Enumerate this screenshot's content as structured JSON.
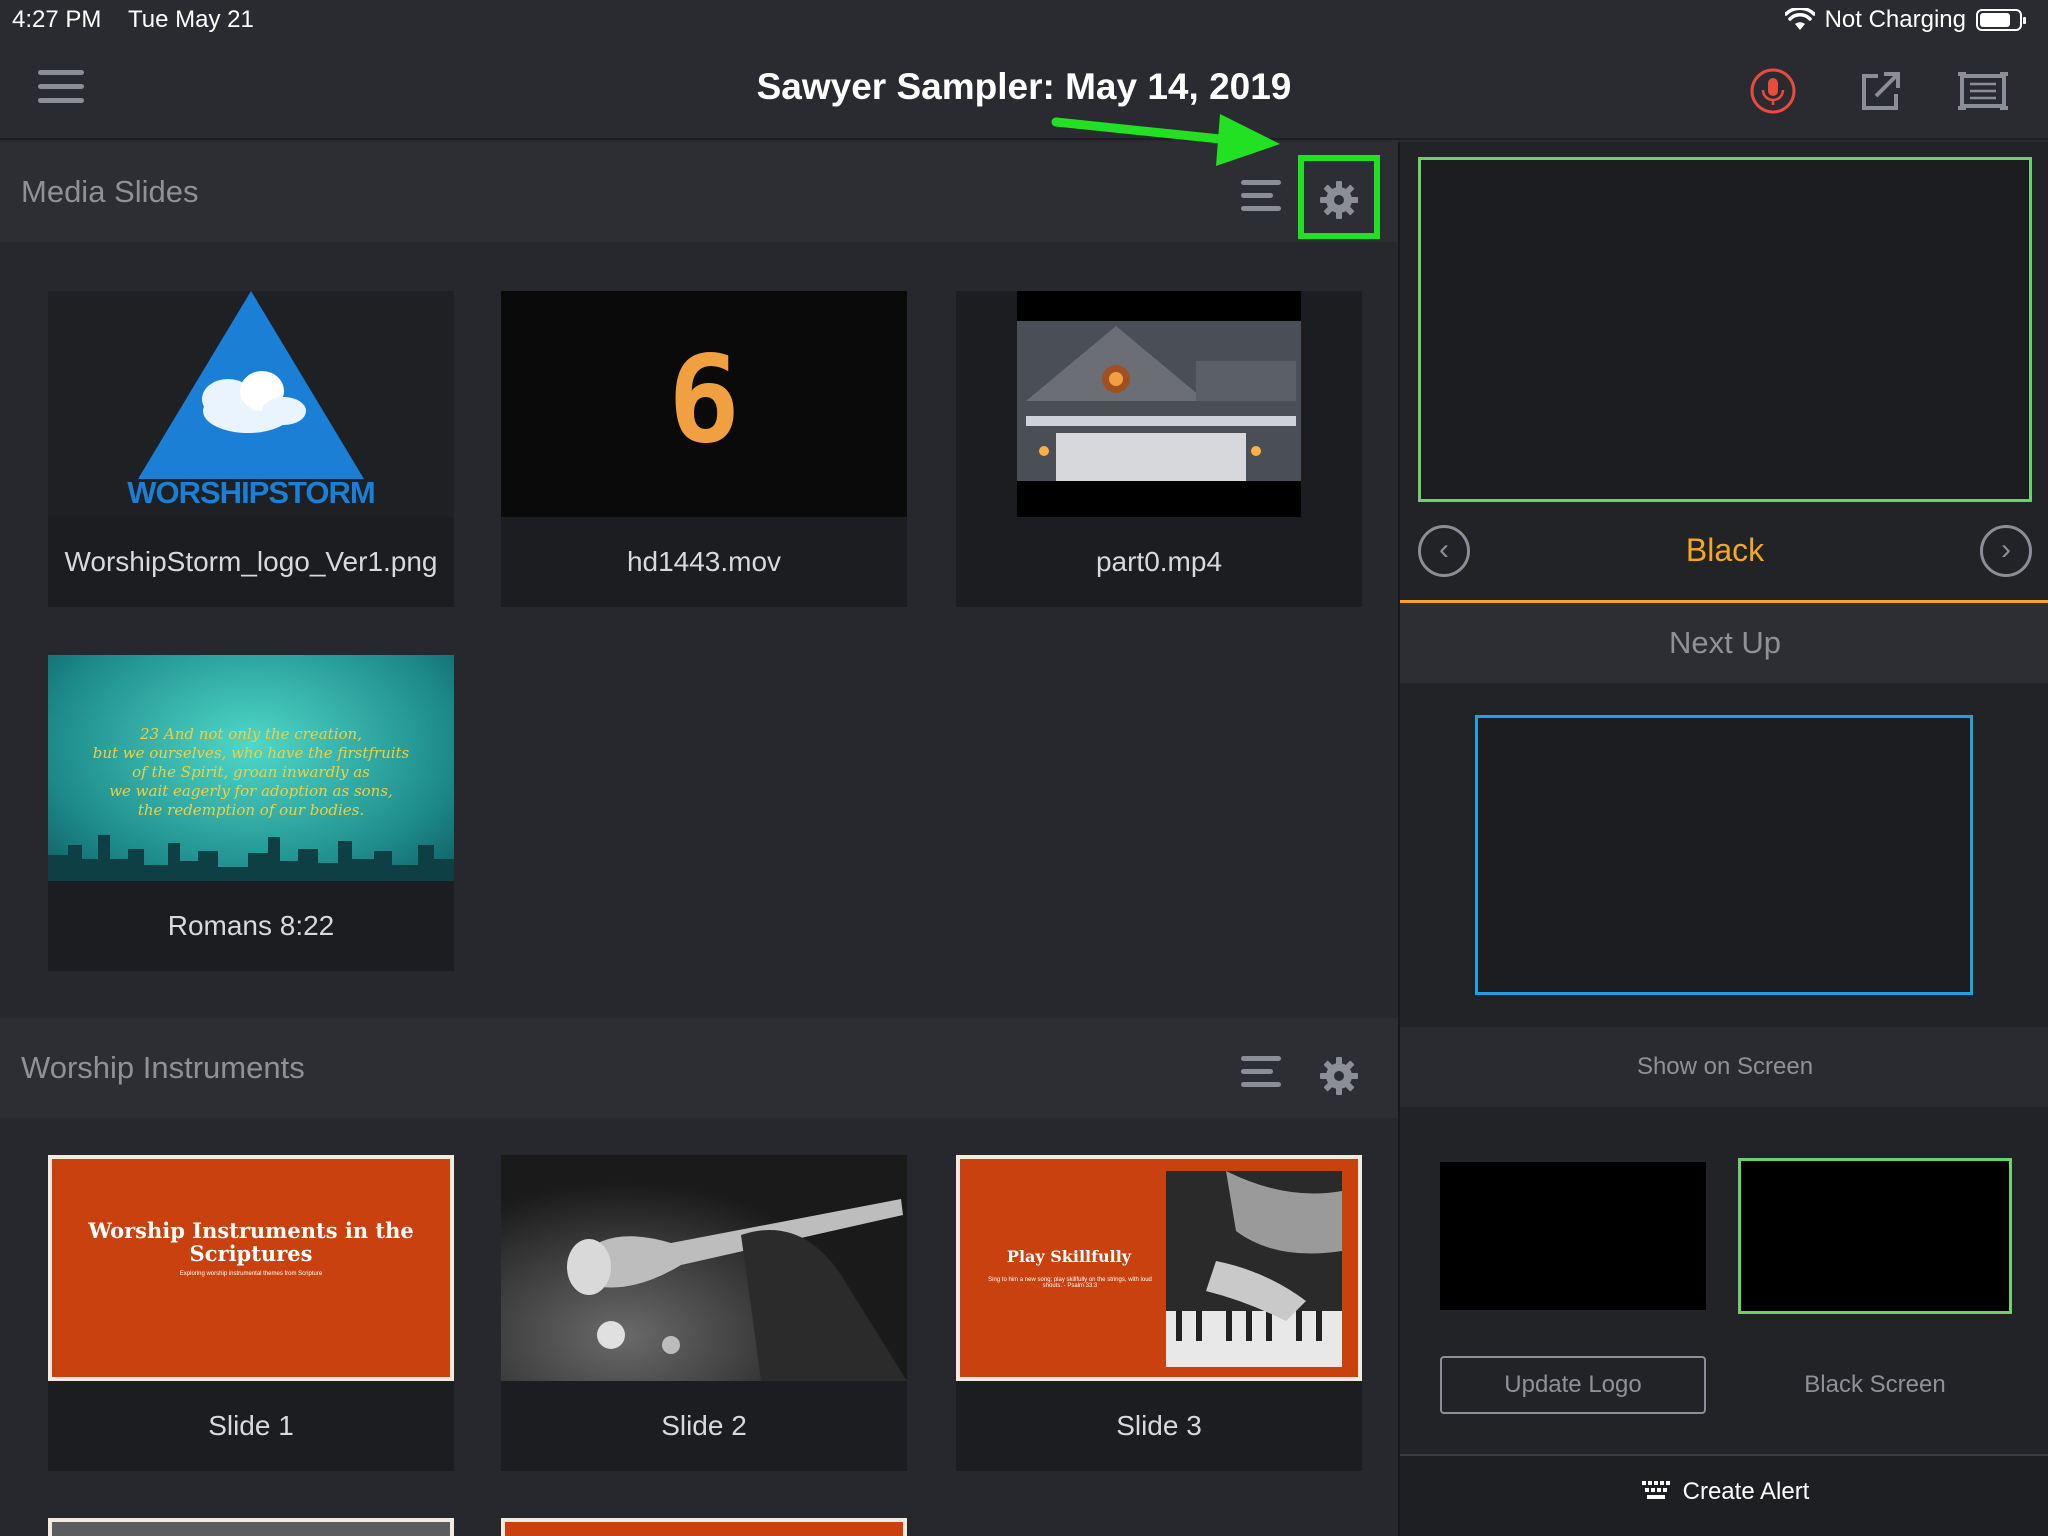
{
  "status_bar": {
    "time": "4:27 PM",
    "date": "Tue May 21",
    "charging": "Not Charging",
    "icons": [
      "wifi-icon",
      "battery-icon"
    ]
  },
  "header": {
    "title": "Sawyer Sampler: May 14, 2019",
    "icons": [
      "menu-icon",
      "microphone-icon",
      "edit-icon",
      "screen-icon"
    ],
    "accent_color": "#e74c3c"
  },
  "sections": [
    {
      "title": "Media Slides",
      "items": [
        {
          "label": "WorshipStorm_logo_Ver1.png",
          "logo_text": "WORSHIPSTORM"
        },
        {
          "label": "hd1443.mov",
          "thumb_text": "6"
        },
        {
          "label": "part0.mp4"
        },
        {
          "label": "Romans 8:22",
          "verse_lines": [
            "23 And not only the creation,",
            "but we ourselves, who have the firstfruits",
            "of the Spirit, groan inwardly as",
            "we wait eagerly for adoption as sons,",
            "the redemption of our bodies."
          ]
        }
      ]
    },
    {
      "title": "Worship Instruments",
      "items": [
        {
          "label": "Slide 1",
          "thumb_title": "Worship Instruments in the Scriptures",
          "thumb_subtitle": "Exploring worship instrumental themes from Scripture"
        },
        {
          "label": "Slide 2"
        },
        {
          "label": "Slide 3",
          "thumb_title": "Play Skillfully",
          "thumb_subtitle": "Sing to him a new song; play skillfully on the strings, with loud shouts. - Psalm 33:3"
        }
      ]
    }
  ],
  "right_panel": {
    "live_label": "Black",
    "next_up": "Next Up",
    "show_on_screen": "Show on Screen",
    "update_logo": "Update Logo",
    "black_screen": "Black Screen",
    "create_alert": "Create Alert",
    "colors": {
      "live_border": "#6bd26b",
      "next_border": "#1fa3e0",
      "accent": "#f5a623"
    }
  },
  "annotation": {
    "highlight_color": "#22e022",
    "target": "gear-icon"
  }
}
